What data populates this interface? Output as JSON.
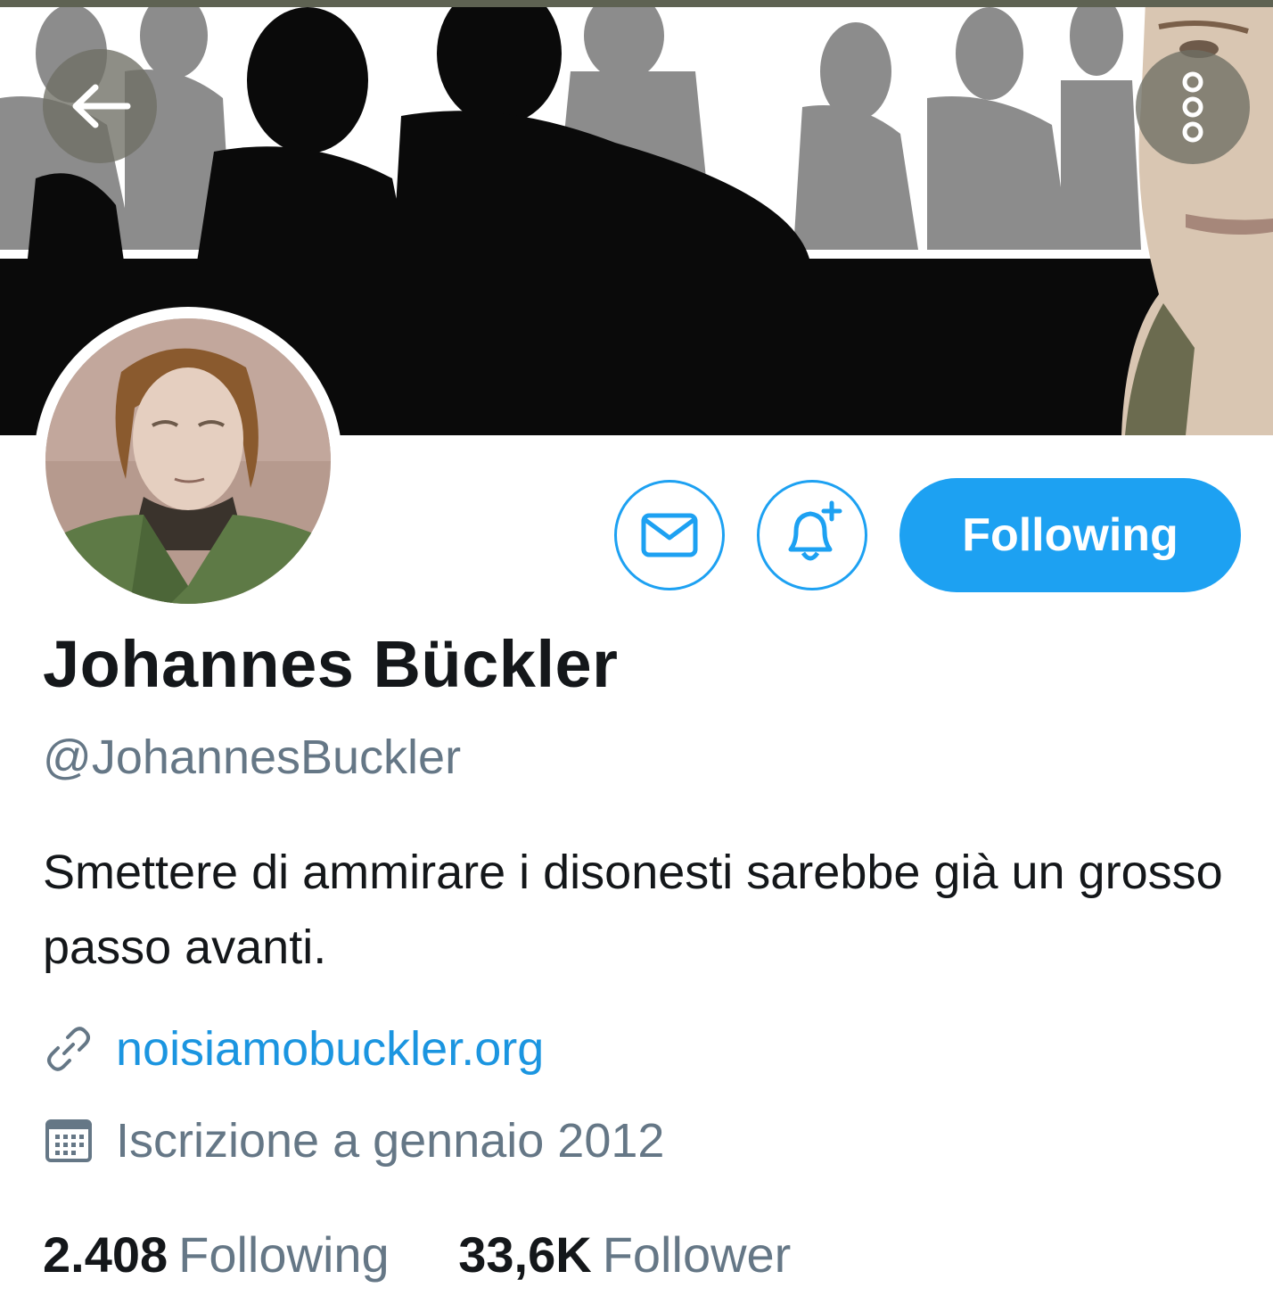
{
  "header": {
    "back_icon": "arrow-left-icon",
    "more_icon": "more-vertical-icon"
  },
  "actions": {
    "message_icon": "envelope-icon",
    "notify_icon": "bell-plus-icon",
    "follow_label": "Following",
    "accent_color": "#1da1f2"
  },
  "profile": {
    "name": "Johannes Bückler",
    "handle": "@JohannesBuckler",
    "bio": "Smettere di ammirare i disonesti sarebbe già un grosso passo avanti.",
    "website": "noisiamobuckler.org",
    "joined": "Iscrizione a gennaio 2012"
  },
  "stats": {
    "following_count": "2.408",
    "following_label": "Following",
    "followers_count": "33,6K",
    "followers_label": "Follower"
  }
}
